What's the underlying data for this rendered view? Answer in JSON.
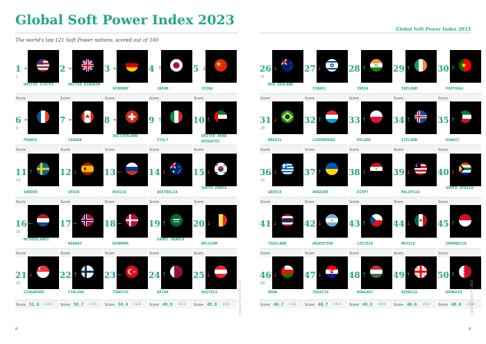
{
  "left_page": {
    "title": "Global Soft Power Index 2023",
    "subtitle": "The world's top 121 Soft Power nations, scored out of 100",
    "page_number": "8",
    "credit": "© Brand Finance Plc 2023"
  },
  "right_page": {
    "header_title": "Global Soft Power Index 2023",
    "page_number": "9",
    "credit": "© Brand Finance Plc 2023"
  },
  "score_label": "Score",
  "countries_left": [
    {
      "rank": "1",
      "arrow": "same",
      "prev": "1",
      "name": "UNITED STATES",
      "score": "",
      "change": "",
      "flag": "us"
    },
    {
      "rank": "2",
      "arrow": "same",
      "prev": "",
      "name": "UNITED KINGDOM",
      "score": "",
      "change": "",
      "flag": "uk"
    },
    {
      "rank": "3",
      "arrow": "same",
      "prev": "",
      "name": "GERMANY",
      "score": "",
      "change": "",
      "flag": "de"
    },
    {
      "rank": "4",
      "arrow": "up",
      "prev": "",
      "name": "JAPAN",
      "score": "",
      "change": "",
      "flag": "jp"
    },
    {
      "rank": "5",
      "arrow": "down",
      "prev": "",
      "name": "CHINA",
      "score": "",
      "change": "",
      "flag": "cn"
    },
    {
      "rank": "6",
      "arrow": "same",
      "prev": "6",
      "name": "FRANCE",
      "score": "",
      "change": "",
      "flag": "fr"
    },
    {
      "rank": "7",
      "arrow": "same",
      "prev": "",
      "name": "CANADA",
      "score": "",
      "change": "",
      "flag": "ca"
    },
    {
      "rank": "8",
      "arrow": "same",
      "prev": "",
      "name": "SWITZERLAND",
      "score": "",
      "change": "",
      "flag": "ch"
    },
    {
      "rank": "9",
      "arrow": "up",
      "prev": "",
      "name": "ITALY",
      "score": "",
      "change": "",
      "flag": "it"
    },
    {
      "rank": "10",
      "arrow": "up",
      "prev": "",
      "name": "UNITED ARAB EMIRATES",
      "score": "",
      "change": "",
      "flag": "ae"
    },
    {
      "rank": "11",
      "arrow": "up",
      "prev": "14",
      "name": "SWEDEN",
      "score": "",
      "change": "",
      "flag": "se"
    },
    {
      "rank": "12",
      "arrow": "down",
      "prev": "",
      "name": "SPAIN",
      "score": "",
      "change": "",
      "flag": "es"
    },
    {
      "rank": "13",
      "arrow": "same",
      "prev": "",
      "name": "RUSSIA",
      "score": "",
      "change": "",
      "flag": "ru"
    },
    {
      "rank": "14",
      "arrow": "down",
      "prev": "",
      "name": "AUSTRALIA",
      "score": "",
      "change": "",
      "flag": "au"
    },
    {
      "rank": "15",
      "arrow": "down",
      "prev": "",
      "name": "SOUTH KOREA",
      "score": "",
      "change": "",
      "flag": "kr"
    },
    {
      "rank": "16",
      "arrow": "same",
      "prev": "16",
      "name": "NETHERLANDS",
      "score": "",
      "change": "",
      "flag": "nl"
    },
    {
      "rank": "17",
      "arrow": "same",
      "prev": "",
      "name": "NORWAY",
      "score": "",
      "change": "",
      "flag": "no"
    },
    {
      "rank": "18",
      "arrow": "same",
      "prev": "",
      "name": "DENMARK",
      "score": "",
      "change": "",
      "flag": "dk"
    },
    {
      "rank": "19",
      "arrow": "up",
      "prev": "",
      "name": "SAUDI ARABIA",
      "score": "",
      "change": "",
      "flag": "sa"
    },
    {
      "rank": "20",
      "arrow": "down",
      "prev": "",
      "name": "BELGIUM",
      "score": "",
      "change": "",
      "flag": "be"
    },
    {
      "rank": "21",
      "arrow": "down",
      "prev": "20",
      "name": "SINGAPORE",
      "score": "51.6",
      "change": "+2.6",
      "flag": "sg"
    },
    {
      "rank": "22",
      "arrow": "up",
      "prev": "",
      "name": "FINLAND",
      "score": "50.7",
      "change": "+3.5",
      "flag": "fi"
    },
    {
      "rank": "23",
      "arrow": "same",
      "prev": "",
      "name": "TÜRKIYE",
      "score": "50.4",
      "change": "+2.6",
      "flag": "tr"
    },
    {
      "rank": "24",
      "arrow": "up",
      "prev": "",
      "name": "QATAR",
      "score": "49.9",
      "change": "+4.1",
      "flag": "qa"
    },
    {
      "rank": "25",
      "arrow": "down",
      "prev": "",
      "name": "AUSTRIA",
      "score": "49.8",
      "change": "+4.5",
      "flag": "at"
    }
  ],
  "countries_right": [
    {
      "rank": "26",
      "arrow": "down",
      "prev": "21",
      "name": "NEW ZEALAND",
      "score": "",
      "change": "",
      "flag": "nz"
    },
    {
      "rank": "27",
      "arrow": "down",
      "prev": "",
      "name": "ISRAEL",
      "score": "",
      "change": "",
      "flag": "il"
    },
    {
      "rank": "28",
      "arrow": "up",
      "prev": "",
      "name": "INDIA",
      "score": "",
      "change": "",
      "flag": "in"
    },
    {
      "rank": "29",
      "arrow": "up",
      "prev": "",
      "name": "IRELAND",
      "score": "",
      "change": "",
      "flag": "ie"
    },
    {
      "rank": "30",
      "arrow": "up",
      "prev": "",
      "name": "PORTUGAL",
      "score": "",
      "change": "",
      "flag": "pt"
    },
    {
      "rank": "31",
      "arrow": "down",
      "prev": "28",
      "name": "BRAZIL",
      "score": "",
      "change": "",
      "flag": "br"
    },
    {
      "rank": "32",
      "arrow": "up",
      "prev": "",
      "name": "LUXEMBOURG",
      "score": "",
      "change": "",
      "flag": "lu"
    },
    {
      "rank": "33",
      "arrow": "up",
      "prev": "",
      "name": "POLAND",
      "score": "",
      "change": "",
      "flag": "pl"
    },
    {
      "rank": "34",
      "arrow": "up",
      "prev": "",
      "name": "ICELAND",
      "score": "",
      "change": "",
      "flag": "is"
    },
    {
      "rank": "35",
      "arrow": "up",
      "prev": "",
      "name": "KUWAIT",
      "score": "",
      "change": "",
      "flag": "kw"
    },
    {
      "rank": "36",
      "arrow": "down",
      "prev": "33",
      "name": "GREECE",
      "score": "",
      "change": "",
      "flag": "gr"
    },
    {
      "rank": "37",
      "arrow": "up",
      "prev": "",
      "name": "UKRAINE",
      "score": "",
      "change": "",
      "flag": "ua"
    },
    {
      "rank": "38",
      "arrow": "down",
      "prev": "",
      "name": "EGYPT",
      "score": "",
      "change": "",
      "flag": "eg"
    },
    {
      "rank": "39",
      "arrow": "down",
      "prev": "",
      "name": "MALAYSIA",
      "score": "",
      "change": "",
      "flag": "my"
    },
    {
      "rank": "40",
      "arrow": "down",
      "prev": "",
      "name": "SOUTH AFRICA",
      "score": "",
      "change": "",
      "flag": "za"
    },
    {
      "rank": "41",
      "arrow": "down",
      "prev": "",
      "name": "THAILAND",
      "score": "",
      "change": "",
      "flag": "th"
    },
    {
      "rank": "42",
      "arrow": "down",
      "prev": "",
      "name": "ARGENTINA",
      "score": "",
      "change": "",
      "flag": "ar"
    },
    {
      "rank": "43",
      "arrow": "up",
      "prev": "",
      "name": "CZECHIA",
      "score": "",
      "change": "",
      "flag": "cz"
    },
    {
      "rank": "44",
      "arrow": "down",
      "prev": "",
      "name": "MEXICO",
      "score": "",
      "change": "",
      "flag": "mx"
    },
    {
      "rank": "45",
      "arrow": "up",
      "prev": "",
      "name": "INDONESIA",
      "score": "",
      "change": "",
      "flag": "id"
    },
    {
      "rank": "46",
      "arrow": "down",
      "prev": "49",
      "name": "OMAN",
      "score": "40.7",
      "change": "+0.1",
      "flag": "om"
    },
    {
      "rank": "47",
      "arrow": "down",
      "prev": "",
      "name": "CROATIA",
      "score": "40.7",
      "change": "+0.3",
      "flag": "hr"
    },
    {
      "rank": "48",
      "arrow": "up",
      "prev": "",
      "name": "HUNGARY",
      "score": "40.5",
      "change": "+0.9",
      "flag": "hu"
    },
    {
      "rank": "49",
      "arrow": "up",
      "prev": "",
      "name": "GEORGIA",
      "score": "40.0",
      "change": "+0.3",
      "flag": "ge"
    },
    {
      "rank": "50",
      "arrow": "up",
      "prev": "",
      "name": "BAHRAIN",
      "score": "40.0",
      "change": "+0.8",
      "flag": "bh"
    }
  ]
}
